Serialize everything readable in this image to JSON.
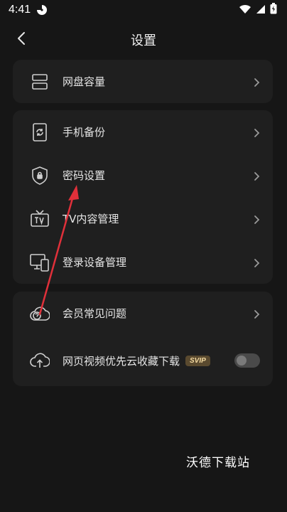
{
  "status_bar": {
    "time": "4:41",
    "app_icon": "pinwheel-icon",
    "icons": [
      "wifi-icon",
      "signal-icon",
      "battery-icon"
    ]
  },
  "header": {
    "back_icon": "chevron-left-icon",
    "title": "设置"
  },
  "sections": [
    {
      "items": [
        {
          "icon": "storage-icon",
          "label": "网盘容量"
        }
      ]
    },
    {
      "items": [
        {
          "icon": "phone-backup-icon",
          "label": "手机备份"
        },
        {
          "icon": "shield-lock-icon",
          "label": "密码设置"
        },
        {
          "icon": "tv-icon",
          "label": "TV内容管理"
        },
        {
          "icon": "devices-icon",
          "label": "登录设备管理"
        }
      ]
    },
    {
      "items": [
        {
          "icon": "help-cloud-icon",
          "label": "会员常见问题"
        },
        {
          "icon": "cloud-upload-icon",
          "label": "网页视频优先云收藏下载",
          "badge": "SVIP",
          "toggle_on": false
        }
      ]
    }
  ],
  "colors": {
    "background": "#161616",
    "card": "#1f1f1f",
    "annotation": "#e0303a",
    "svip_bg": "#5a4a2f",
    "svip_text": "#f3d9a0"
  },
  "watermark": "沃德下载站"
}
